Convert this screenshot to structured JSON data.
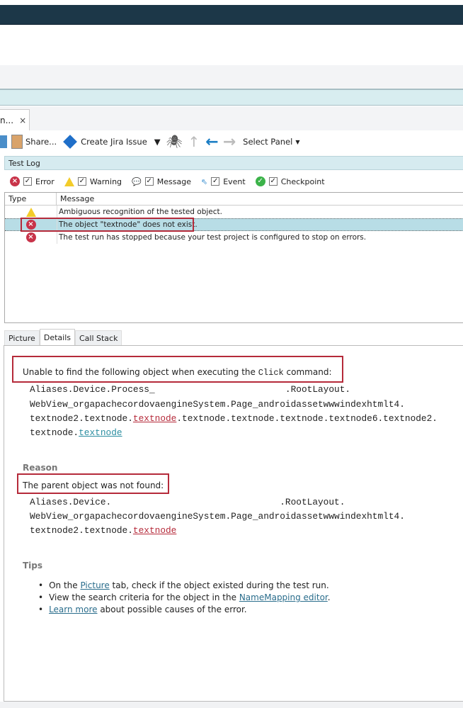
{
  "tab": {
    "title": "n...",
    "close": "×"
  },
  "toolbar": {
    "share": "Share...",
    "jira": "Create Jira Issue",
    "select_panel": "Select Panel"
  },
  "test_log": {
    "title": "Test Log",
    "filters": [
      "Error",
      "Warning",
      "Message",
      "Event",
      "Checkpoint"
    ],
    "columns": [
      "Type",
      "Message"
    ],
    "rows": [
      {
        "type": "warning",
        "message": "Ambiguous recognition of the tested object."
      },
      {
        "type": "error",
        "message": "The object \"textnode\" does not exist."
      },
      {
        "type": "error",
        "message": "The test run has stopped because your test project is configured to stop on errors."
      }
    ]
  },
  "bottom_tabs": [
    "Picture",
    "Details",
    "Call Stack"
  ],
  "details": {
    "intro_pre": "Unable to find the following object when executing the ",
    "intro_cmd": "Click",
    "intro_post": " command:",
    "path1": [
      "Aliases.Device.Process_                        .RootLayout.",
      "WebView_orgapachecordovaengineSystem.Page_androidassetwwwindexhtmlt4.",
      "textnode2.textnode.",
      "textnode",
      ".textnode.textnode.textnode.textnode6.textnode2.",
      "textnode.",
      "textnode"
    ],
    "reason_title": "Reason",
    "reason": "The parent object was not found:",
    "path2": [
      "Aliases.Device.                               .RootLayout.",
      "WebView_orgapachecordovaengineSystem.Page_androidassetwwwindexhtmlt4.",
      "textnode2.textnode.",
      "textnode"
    ],
    "tips_title": "Tips",
    "tips": [
      {
        "pre": "On the ",
        "link": "Picture",
        "post": " tab, check if the object existed during the test run."
      },
      {
        "pre": "View the search criteria for the object in the ",
        "link": "NameMapping editor",
        "post": "."
      },
      {
        "pre": "",
        "link": "Learn more",
        "post": " about possible causes of the error."
      }
    ]
  }
}
